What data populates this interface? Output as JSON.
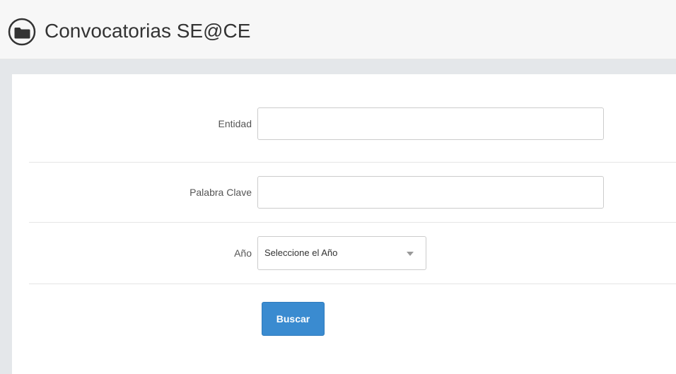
{
  "header": {
    "title": "Convocatorias SE@CE",
    "icon": "folder-circle-icon"
  },
  "form": {
    "entidad": {
      "label": "Entidad",
      "value": "",
      "placeholder": ""
    },
    "palabra_clave": {
      "label": "Palabra Clave",
      "value": "",
      "placeholder": ""
    },
    "anio": {
      "label": "Año",
      "selected": "Seleccione el Año"
    },
    "search_button_label": "Buscar"
  },
  "colors": {
    "primary_button": "#3a8bd0",
    "header_bg": "#f7f7f7",
    "page_bg": "#e4e7ea"
  }
}
